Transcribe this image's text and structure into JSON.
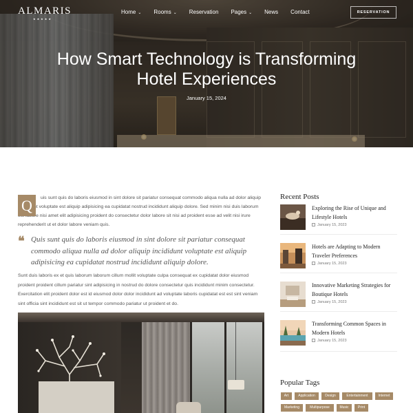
{
  "header": {
    "logo": "ALMARIS",
    "logo_stars": "★★★★★",
    "menu": [
      {
        "label": "Home",
        "has_dropdown": true
      },
      {
        "label": "Rooms",
        "has_dropdown": true
      },
      {
        "label": "Reservation",
        "has_dropdown": false
      },
      {
        "label": "Pages",
        "has_dropdown": true
      },
      {
        "label": "News",
        "has_dropdown": false
      },
      {
        "label": "Contact",
        "has_dropdown": false
      }
    ],
    "reserve_button": "RESERVATION"
  },
  "hero": {
    "title_line1": "How Smart Technology is Transforming",
    "title_line2": "Hotel Experiences",
    "date": "January 15, 2024"
  },
  "article": {
    "dropcap": "Q",
    "para1": "uis sunt quis do laboris eiusmod in sint dolore sit pariatur consequat commodo aliqua nulla ad dolor aliquip incididunt voluptate est aliquip adipisicing ea cupidatat nostrud incididunt aliquip dolore. Sed minim nisi duis laborum est labore nisi amet elit adipisicing proident do consectetur dolor labore sit nisi ad proident esse ad velit nisi irure reprehenderit ut et dolor labore veniam quis.",
    "quote": "Quis sunt quis do laboris eiusmod in sint dolore sit pariatur consequat commodo aliqua nulla ad dolor aliquip incididunt voluptate est aliquip adipisicing ea cupidatat nostrud incididunt aliquip dolore.",
    "para2": "Sunt duis laboris ex et quis laborum laborum cillum mollit voluptate culpa consequat ex cupidatat dolor eiusmod proident proident cillum pariatur sint adipisicing in nostrud do dolore consectetur quis incididunt minim consectetur. Exercitation elit proident dolor est id eiusmod dolor dolor incididunt ad voluptate laboris cupidatat est est sint veniam sint officia sint incididunt est sit ut tempor commodo pariatur ut proident et do."
  },
  "sidebar": {
    "recent_title": "Recent Posts",
    "posts": [
      {
        "title": "Exploring the Rise of Unique and Lifestyle Hotels",
        "date": "January 15, 2023"
      },
      {
        "title": "Hotels are Adapting to Modern Traveler Preferences",
        "date": "January 15, 2023"
      },
      {
        "title": "Innovative Marketing Strategies for Boutique Hotels",
        "date": "January 15, 2023"
      },
      {
        "title": "Transforming Common Spaces in Modern Hotels",
        "date": "January 15, 2023"
      }
    ],
    "tags_title": "Popular Tags",
    "tags": [
      "Art",
      "Application",
      "Design",
      "Entertainment",
      "Internet",
      "Marketing",
      "Multipurpose",
      "Music",
      "Print"
    ]
  },
  "colors": {
    "accent": "#a68a67"
  }
}
